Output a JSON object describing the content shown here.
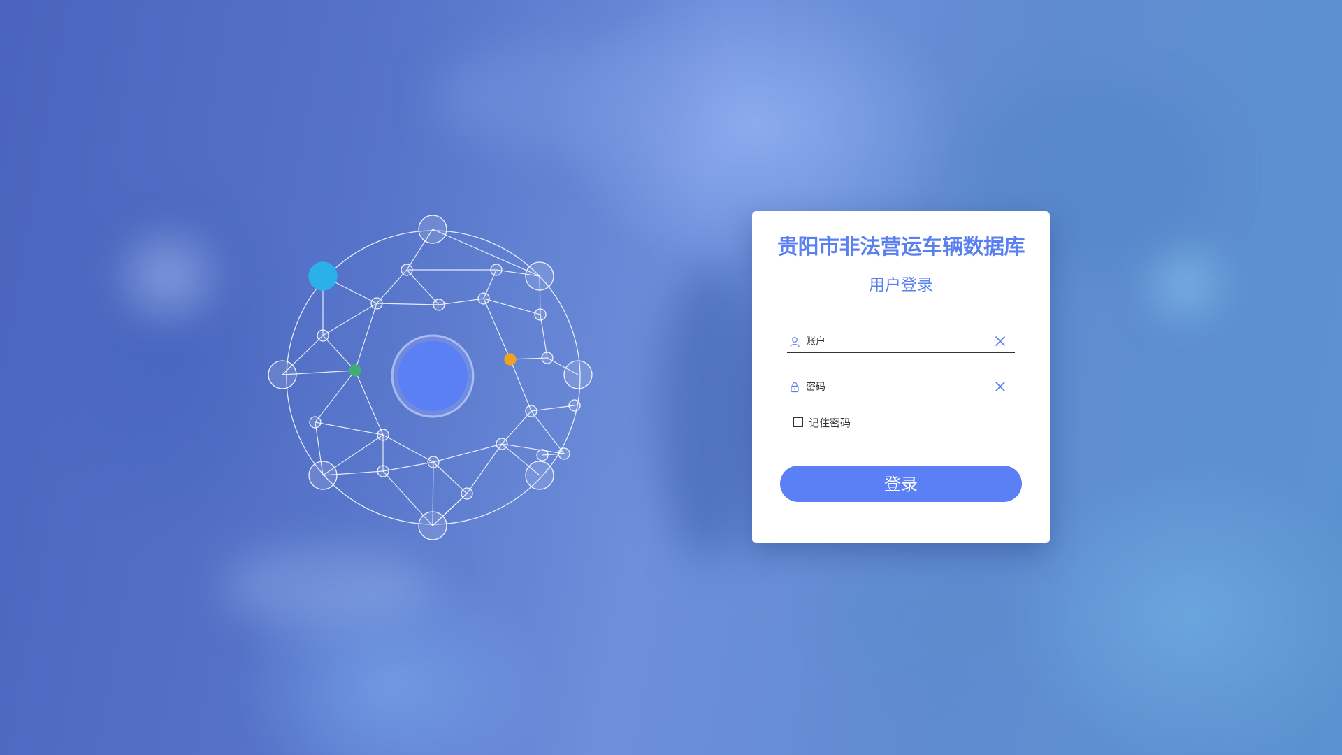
{
  "login": {
    "title": "贵阳市非法营运车辆数据库",
    "subtitle": "用户登录",
    "account": {
      "placeholder": "账户",
      "value": "",
      "icon": "user-icon"
    },
    "password": {
      "placeholder": "密码",
      "value": "",
      "icon": "lock-icon"
    },
    "remember_label": "记住密码",
    "remember_checked": false,
    "submit_label": "登录"
  },
  "colors": {
    "accent": "#5b7ff5",
    "title": "#5a7ff0",
    "node_blue": "#2bb0ea",
    "node_green": "#3fae72",
    "node_orange": "#f0a321",
    "center_node": "#5b7ff5"
  }
}
